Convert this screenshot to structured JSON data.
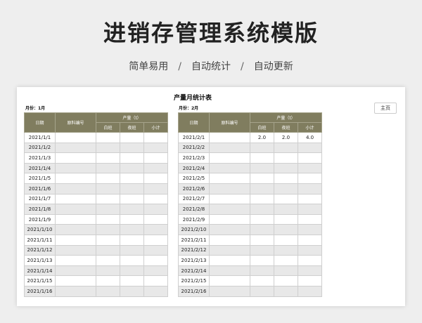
{
  "header": {
    "title": "进销存管理系统模版",
    "features": [
      "简单易用",
      "自动统计",
      "自动更新"
    ],
    "separator": "/"
  },
  "sheet": {
    "title": "产量月统计表",
    "home_button": "主页",
    "columns": {
      "date": "日期",
      "material_code": "原料编号",
      "output": "产量（t）",
      "day_shift": "白班",
      "night_shift": "夜班",
      "subtotal": "小计"
    },
    "left": {
      "month_label": "月份：1月",
      "rows": [
        {
          "date": "2021/1/1",
          "day": "",
          "night": "",
          "sub": ""
        },
        {
          "date": "2021/1/2",
          "day": "",
          "night": "",
          "sub": ""
        },
        {
          "date": "2021/1/3",
          "day": "",
          "night": "",
          "sub": ""
        },
        {
          "date": "2021/1/4",
          "day": "",
          "night": "",
          "sub": ""
        },
        {
          "date": "2021/1/5",
          "day": "",
          "night": "",
          "sub": ""
        },
        {
          "date": "2021/1/6",
          "day": "",
          "night": "",
          "sub": ""
        },
        {
          "date": "2021/1/7",
          "day": "",
          "night": "",
          "sub": ""
        },
        {
          "date": "2021/1/8",
          "day": "",
          "night": "",
          "sub": ""
        },
        {
          "date": "2021/1/9",
          "day": "",
          "night": "",
          "sub": ""
        },
        {
          "date": "2021/1/10",
          "day": "",
          "night": "",
          "sub": ""
        },
        {
          "date": "2021/1/11",
          "day": "",
          "night": "",
          "sub": ""
        },
        {
          "date": "2021/1/12",
          "day": "",
          "night": "",
          "sub": ""
        },
        {
          "date": "2021/1/13",
          "day": "",
          "night": "",
          "sub": ""
        },
        {
          "date": "2021/1/14",
          "day": "",
          "night": "",
          "sub": ""
        },
        {
          "date": "2021/1/15",
          "day": "",
          "night": "",
          "sub": ""
        },
        {
          "date": "2021/1/16",
          "day": "",
          "night": "",
          "sub": ""
        }
      ]
    },
    "right": {
      "month_label": "月份：2月",
      "rows": [
        {
          "date": "2021/2/1",
          "day": "2.0",
          "night": "2.0",
          "sub": "4.0"
        },
        {
          "date": "2021/2/2",
          "day": "",
          "night": "",
          "sub": ""
        },
        {
          "date": "2021/2/3",
          "day": "",
          "night": "",
          "sub": ""
        },
        {
          "date": "2021/2/4",
          "day": "",
          "night": "",
          "sub": ""
        },
        {
          "date": "2021/2/5",
          "day": "",
          "night": "",
          "sub": ""
        },
        {
          "date": "2021/2/6",
          "day": "",
          "night": "",
          "sub": ""
        },
        {
          "date": "2021/2/7",
          "day": "",
          "night": "",
          "sub": ""
        },
        {
          "date": "2021/2/8",
          "day": "",
          "night": "",
          "sub": ""
        },
        {
          "date": "2021/2/9",
          "day": "",
          "night": "",
          "sub": ""
        },
        {
          "date": "2021/2/10",
          "day": "",
          "night": "",
          "sub": ""
        },
        {
          "date": "2021/2/11",
          "day": "",
          "night": "",
          "sub": ""
        },
        {
          "date": "2021/2/12",
          "day": "",
          "night": "",
          "sub": ""
        },
        {
          "date": "2021/2/13",
          "day": "",
          "night": "",
          "sub": ""
        },
        {
          "date": "2021/2/14",
          "day": "",
          "night": "",
          "sub": ""
        },
        {
          "date": "2021/2/15",
          "day": "",
          "night": "",
          "sub": ""
        },
        {
          "date": "2021/2/16",
          "day": "",
          "night": "",
          "sub": ""
        }
      ]
    },
    "colors": {
      "header_bg": "#807d5f",
      "alt_row": "#e8e8e8"
    }
  }
}
